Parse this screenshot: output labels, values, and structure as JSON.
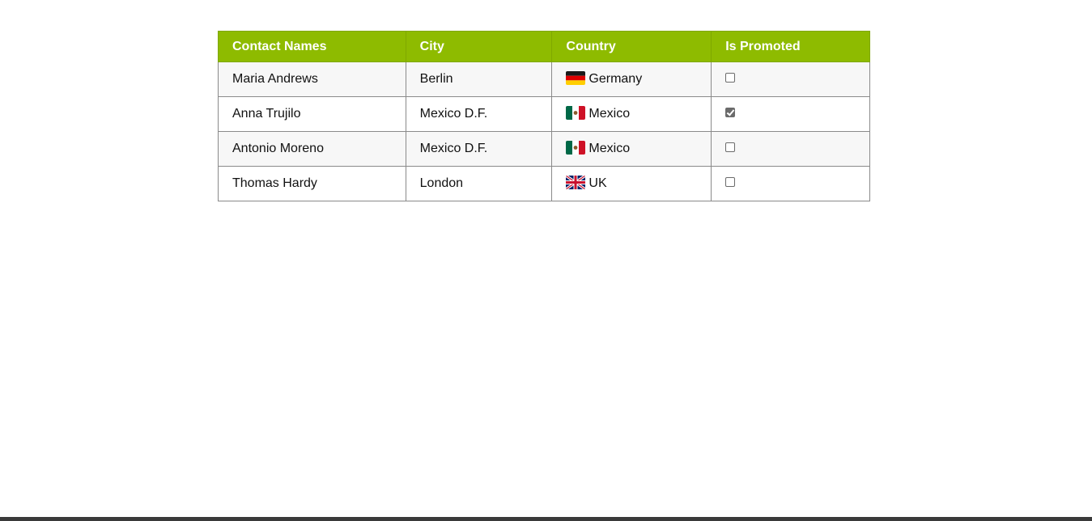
{
  "table": {
    "headers": {
      "name": "Contact Names",
      "city": "City",
      "country": "Country",
      "promoted": "Is Promoted"
    },
    "rows": [
      {
        "name": "Maria Andrews",
        "city": "Berlin",
        "country": "Germany",
        "flag": "germany-flag-icon",
        "promoted": false
      },
      {
        "name": "Anna Trujilo",
        "city": "Mexico D.F.",
        "country": "Mexico",
        "flag": "mexico-flag-icon",
        "promoted": true
      },
      {
        "name": "Antonio Moreno",
        "city": "Mexico D.F.",
        "country": "Mexico",
        "flag": "mexico-flag-icon",
        "promoted": false
      },
      {
        "name": "Thomas Hardy",
        "city": "London",
        "country": "UK",
        "flag": "uk-flag-icon",
        "promoted": false
      }
    ]
  },
  "colors": {
    "header_bg": "#8ebb00",
    "header_text": "#ffffff",
    "border": "#8a8a8a"
  }
}
